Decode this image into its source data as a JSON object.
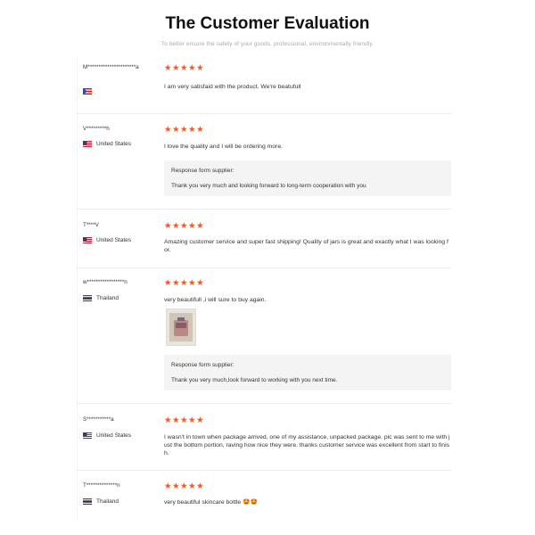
{
  "page": {
    "title": "The Customer Evaluation",
    "subtitle": "To better ensure the safety of your goods, professional, environmentally friendly."
  },
  "stars": "★★★★★",
  "reviews": [
    {
      "name": "M**********************a",
      "country": "",
      "flag": "puerto-rico",
      "text": "I am very satisfaid with the product. We're beatufull",
      "response": null
    },
    {
      "name": "V*********h",
      "country": "United States",
      "flag": "usa",
      "text": "I love the quality and I will be ordering more.",
      "response": {
        "label": "Response form supplier:",
        "text": "Thank you very much and looking forward to long-term cooperation with you"
      }
    },
    {
      "name": "T****V",
      "country": "United States",
      "flag": "usa",
      "text": "Amazing customer service and super fast shipping! Quality of jars is great and exactly what I was looking for.",
      "response": null
    },
    {
      "name": "w*****************n",
      "country": "Thailand",
      "flag": "thailand",
      "text": "very beautifull ,i will sure to buy again.",
      "response": {
        "label": "Response form supplier:",
        "text": "Thank you very much,look forward to working with you next time."
      }
    },
    {
      "name": "S***********a",
      "country": "United States",
      "flag": "usa",
      "text": "I wasn't in town when package arrived, one of my assistance, unpacked package. pic was sent to me with just the bottom portion, raving how nice they were. thanks customer service was excellent from start to finish.",
      "response": null
    },
    {
      "name": "T**************n",
      "country": "Thailand",
      "flag": "thailand",
      "text": "very beautiful skincare bottle 🤩🤩",
      "response": null
    }
  ]
}
